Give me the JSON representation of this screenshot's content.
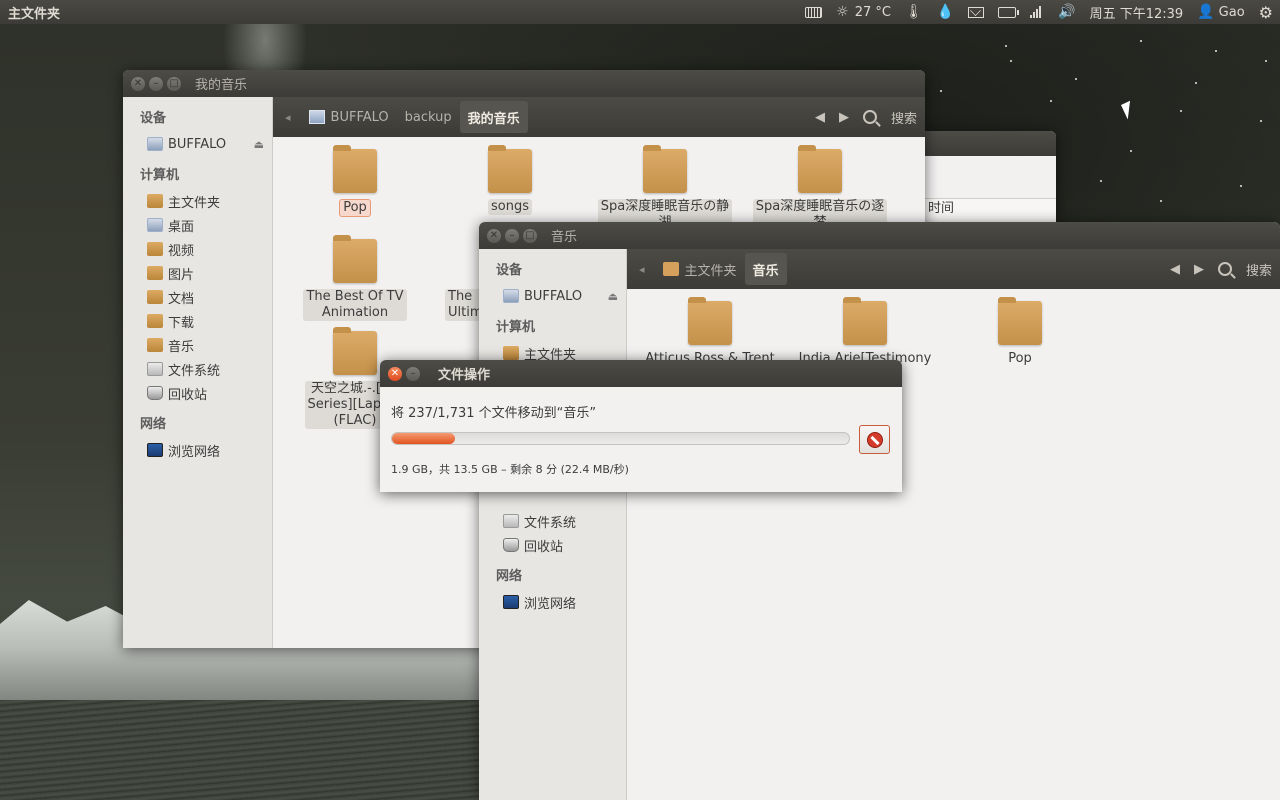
{
  "top_panel": {
    "app_title": "主文件夹",
    "temperature": "27 °C",
    "clock": "周五 下午12:39",
    "user": "Gao"
  },
  "bg_window": {
    "partial_label": "时间"
  },
  "window_mymusic": {
    "title": "我的音乐",
    "breadcrumbs": [
      "BUFFALO",
      "backup",
      "我的音乐"
    ],
    "search_label": "搜索",
    "sidebar": {
      "devices_header": "设备",
      "device": "BUFFALO",
      "computer_header": "计算机",
      "places": [
        "主文件夹",
        "桌面",
        "视频",
        "图片",
        "文档",
        "下载",
        "音乐",
        "文件系统",
        "回收站"
      ],
      "network_header": "网络",
      "network_item": "浏览网络"
    },
    "files": [
      {
        "l1": "Pop",
        "l2": "",
        "l3": ""
      },
      {
        "l1": "songs",
        "l2": "",
        "l3": ""
      },
      {
        "l1": "Spa深度睡眠音乐の静",
        "l2": "湖",
        "l3": ""
      },
      {
        "l1": "Spa深度睡眠音乐の逐",
        "l2": "梦",
        "l3": ""
      },
      {
        "l1": "The Best Of TV",
        "l2": "Animation",
        "l3": ""
      },
      {
        "l1": "The",
        "l2": "Ultim",
        "l3": ""
      },
      {
        "l1": "天空之城.-.[Hi-",
        "l2": "Series][Laputa",
        "l3": "(FLAC)"
      }
    ]
  },
  "window_music": {
    "title": "音乐",
    "breadcrumbs": [
      "主文件夹",
      "音乐"
    ],
    "search_label": "搜索",
    "sidebar": {
      "devices_header": "设备",
      "device": "BUFFALO",
      "computer_header": "计算机",
      "place_home": "主文件夹",
      "place_fs": "文件系统",
      "place_trash": "回收站",
      "network_header": "网络",
      "network_item": "浏览网络"
    },
    "files": [
      {
        "l1": "Atticus Ross & Trent"
      },
      {
        "l1": "India.Arie[Testimony"
      },
      {
        "l1": "Pop"
      }
    ]
  },
  "dialog": {
    "title": "文件操作",
    "status": "将 237/1,731 个文件移动到“音乐”",
    "progress_fraction": 0.137,
    "details": "1.9 GB，共 13.5 GB – 剩余 8 分 (22.4 MB/秒)"
  },
  "colors": {
    "progress": "#e2541f",
    "panel_bg": "#3c3b37",
    "window_bg": "#f2f1f0"
  },
  "icons": [
    "keyboard-icon",
    "weather-icon",
    "thermometer-icon",
    "drop-icon",
    "mail-icon",
    "battery-icon",
    "network-icon",
    "volume-icon",
    "user-icon",
    "gear-icon"
  ]
}
